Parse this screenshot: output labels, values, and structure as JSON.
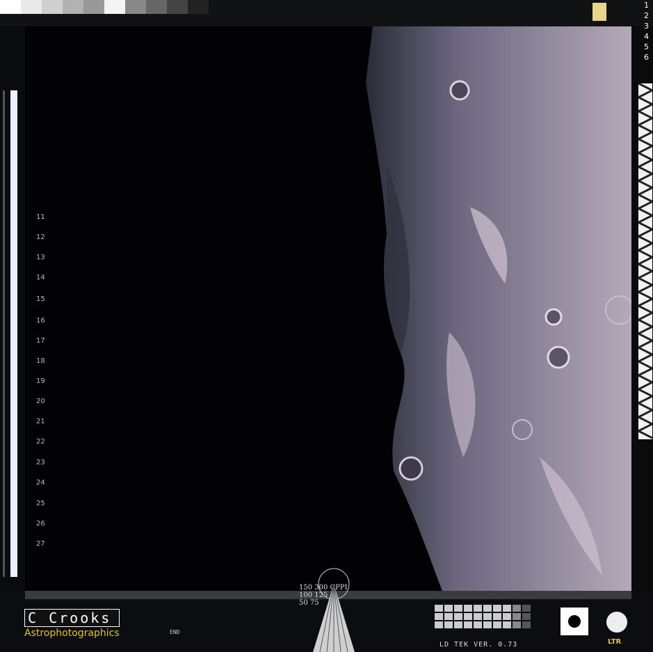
{
  "frame": {
    "side_numbers": [
      "1",
      "2",
      "3",
      "4",
      "5",
      "6"
    ],
    "scale_numbers": [
      "11",
      "12",
      "13",
      "14",
      "15",
      "16",
      "17",
      "18",
      "19",
      "20",
      "21",
      "22",
      "23",
      "24",
      "25",
      "26",
      "27"
    ]
  },
  "brand": {
    "name": "C Crooks",
    "subtitle": "Astrophotographics"
  },
  "labels": {
    "end": "END",
    "ppi": "150   300 CPPI",
    "ppi_row2": "100        125",
    "ppi_row3": "50           75",
    "version": "LD TEK VER. 0.73",
    "ltr": "LTR"
  },
  "colors": {
    "accent_yellow": "#e7c41e",
    "frame_dark": "#0a0b0d"
  }
}
